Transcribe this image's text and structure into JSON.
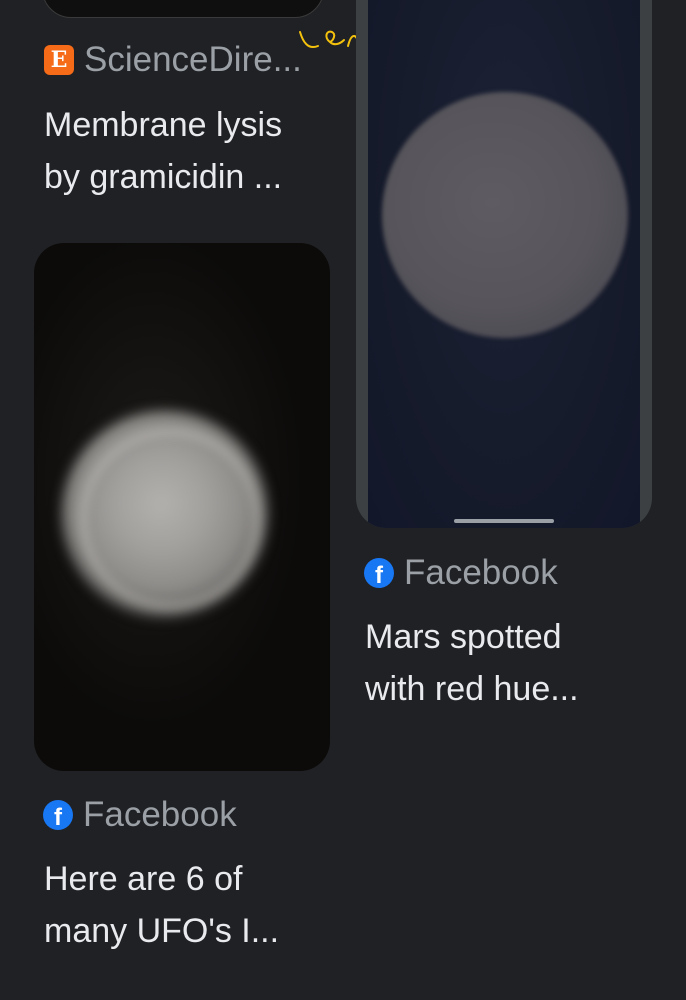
{
  "results": [
    {
      "source": "ScienceDire...",
      "title_line1": "Membrane lysis",
      "title_line2": "by gramicidin ...",
      "icon": "elsevier-icon"
    },
    {
      "source": "Facebook",
      "title_line1": "Mars spotted",
      "title_line2": "with red hue...",
      "icon": "facebook-icon"
    },
    {
      "source": "Facebook",
      "title_line1": "Here are 6 of",
      "title_line2": "many UFO's I...",
      "icon": "facebook-icon"
    }
  ],
  "annotation": {
    "text": "Lens",
    "color": "#f4c20d"
  },
  "colors": {
    "background": "#202124",
    "source_text": "#9aa0a6",
    "title_text": "#e8eaed",
    "facebook_blue": "#1877f2",
    "elsevier_orange": "#f56b17"
  }
}
